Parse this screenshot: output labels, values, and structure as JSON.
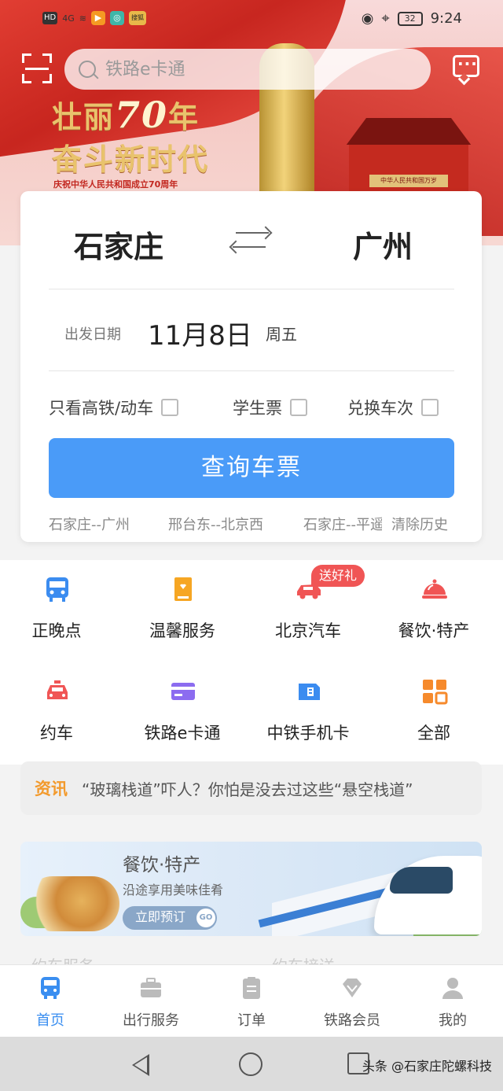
{
  "status_bar": {
    "left_indicators": [
      "HD",
      "4G",
      "≋",
      "▶",
      "◎",
      "搜狐"
    ],
    "battery": "32",
    "time": "9:24",
    "icons": [
      "eye-icon",
      "location-icon",
      "battery-icon"
    ]
  },
  "hero": {
    "slogan_part1": "壮丽",
    "slogan_70": "70",
    "slogan_part2": "年",
    "slogan_line2": "奋斗新时代",
    "slogan_line3": "庆祝中华人民共和国成立70周年",
    "gate_plaque": "中华人民共和国万岁"
  },
  "search": {
    "placeholder": "铁路e卡通",
    "icons": [
      "scan-icon",
      "search-icon",
      "message-icon"
    ]
  },
  "ticket": {
    "from": "石家庄",
    "to": "广州",
    "date_label": "出发日期",
    "date_value": "11月8日",
    "weekday": "周五",
    "options": [
      "只看高铁/动车",
      "学生票",
      "兑换车次"
    ],
    "query_button": "查询车票",
    "history": [
      "石家庄--广州",
      "邢台东--北京西",
      "石家庄--平遥"
    ],
    "clear_history": "清除历史"
  },
  "quick_services": [
    {
      "label": "正晚点",
      "icon": "train-icon",
      "color": "#3b8cf0"
    },
    {
      "label": "温馨服务",
      "icon": "bookmark-icon",
      "color": "#f6a623"
    },
    {
      "label": "北京汽车",
      "icon": "car-icon",
      "color": "#f05555",
      "badge": "送好礼"
    },
    {
      "label": "餐饮·特产",
      "icon": "food-cover-icon",
      "color": "#f05555"
    },
    {
      "label": "约车",
      "icon": "taxi-icon",
      "color": "#f05555"
    },
    {
      "label": "铁路e卡通",
      "icon": "card-icon",
      "color": "#8c6cf0"
    },
    {
      "label": "中铁手机卡",
      "icon": "sim-icon",
      "color": "#3b8cf0"
    },
    {
      "label": "全部",
      "icon": "grid-icon",
      "color": "#f68a2c"
    }
  ],
  "news": {
    "tag": "资讯",
    "text": "“玻璃栈道”吓人？你怕是没去过这些“悬空栈道”"
  },
  "promo": {
    "title": "餐饮·特产",
    "subtitle": "沿途享用美味佳肴",
    "button": "立即预订",
    "go": "GO"
  },
  "peek_text": [
    "约车服务",
    "约车接送"
  ],
  "tabbar": [
    {
      "label": "首页",
      "icon": "home-train-icon",
      "active": true
    },
    {
      "label": "出行服务",
      "icon": "briefcase-icon",
      "active": false
    },
    {
      "label": "订单",
      "icon": "order-icon",
      "active": false
    },
    {
      "label": "铁路会员",
      "icon": "diamond-icon",
      "active": false
    },
    {
      "label": "我的",
      "icon": "user-icon",
      "active": false
    }
  ],
  "watermark": "头条 @石家庄陀螺科技",
  "colors": {
    "accent": "#4a9bf8",
    "active_tab": "#3a8ef0",
    "news_tag": "#f39a2c"
  }
}
